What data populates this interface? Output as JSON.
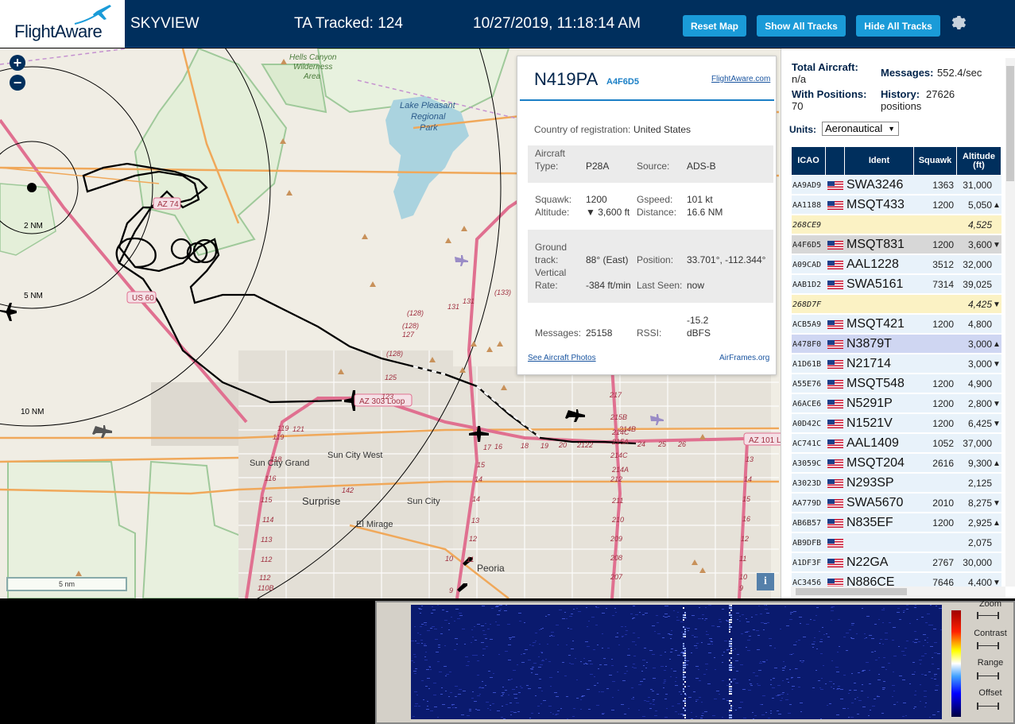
{
  "header": {
    "logo_text": "FlightAware",
    "title": "SKYVIEW",
    "tracked": "TA Tracked: 124",
    "datetime": "10/27/2019, 11:18:14 AM",
    "reset_map": "Reset Map",
    "show_all": "Show All Tracks",
    "hide_all": "Hide All Tracks"
  },
  "map": {
    "zoom_in": "+",
    "zoom_out": "−",
    "range_rings": [
      "2 NM",
      "5 NM",
      "10 NM"
    ],
    "scale": "5 nm",
    "info": "i",
    "place_labels": [
      "Hells Canyon Wilderness Area",
      "Lake Pleasant Regional Park",
      "Sun City Grand",
      "Sun City West",
      "Surprise",
      "Sun City",
      "El Mirage",
      "Peoria"
    ],
    "road_shields": [
      "AZ 74",
      "US 60",
      "AZ 303 Loop",
      "AZ 101 Lo"
    ],
    "road_numbers": [
      "131",
      "(128)",
      "127",
      "(133)",
      "(128)",
      "125",
      "123",
      "121",
      "119",
      "118",
      "117",
      "116",
      "115",
      "114",
      "113",
      "112",
      "110B",
      "142",
      "18",
      "17",
      "16",
      "15",
      "14",
      "13",
      "12",
      "11",
      "10",
      "9",
      "217",
      "215B",
      "214C",
      "214B",
      "215A",
      "214C",
      "212",
      "214A",
      "211",
      "210",
      "209",
      "208",
      "207",
      "24",
      "25",
      "26",
      "22",
      "21",
      "20",
      "19",
      "13",
      "12",
      "11",
      "10",
      "9",
      "14",
      "15",
      "16"
    ]
  },
  "popup": {
    "registration": "N419PA",
    "hex": "A4F6D5",
    "fa_link": "FlightAware.com",
    "country_label": "Country of registration:",
    "country": "United States",
    "aircraft_type_label": "Aircraft Type:",
    "aircraft_type_label_1": "Aircraft",
    "aircraft_type_label_2": "Type:",
    "aircraft_type": "P28A",
    "source_label": "Source:",
    "source": "ADS-B",
    "squawk_label": "Squawk:",
    "squawk": "1200",
    "gspeed_label": "Gspeed:",
    "gspeed": "101 kt",
    "altitude_label": "Altitude:",
    "altitude": "▼ 3,600 ft",
    "distance_label": "Distance:",
    "distance": "16.6 NM",
    "ground_track_label_1": "Ground",
    "ground_track_label_2": "track:",
    "ground_track": "88° (East)",
    "position_label": "Position:",
    "position": "33.701°, -112.344°",
    "vrate_label_1": "Vertical",
    "vrate_label_2": "Rate:",
    "vrate": "-384 ft/min",
    "last_seen_label": "Last Seen:",
    "last_seen": "now",
    "messages_label": "Messages:",
    "messages": "25158",
    "rssi_label": "RSSI:",
    "rssi_1": "-15.2",
    "rssi_2": "dBFS",
    "photos_link": "See Aircraft Photos",
    "airframes_link": "AirFrames.org"
  },
  "sidebar": {
    "total_label": "Total Aircraft:",
    "total": "n/a",
    "messages_label": "Messages:",
    "messages": "552.4/sec",
    "with_pos_label": "With Positions:",
    "with_pos": "70",
    "history_label": "History:",
    "history_1": "27626",
    "history_2": "positions",
    "units_label": "Units:",
    "units": "Aeronautical",
    "columns": [
      "ICAO",
      "",
      "Ident",
      "Squawk",
      "Altitude (ft)"
    ],
    "col_alt_1": "Altitude",
    "col_alt_2": "(ft)",
    "rows": [
      {
        "icao": "AA9AD9",
        "flag": true,
        "ident": "SWA3246",
        "squawk": "1363",
        "alt": "31,000",
        "trend": "",
        "bg": "#e8f2fa"
      },
      {
        "icao": "AA1188",
        "flag": true,
        "ident": "MSQT433",
        "squawk": "1200",
        "alt": "5,050",
        "trend": "▲",
        "bg": "#e8f2fa"
      },
      {
        "icao": "268CE9",
        "flag": false,
        "ident": "",
        "squawk": "",
        "alt": "4,525",
        "trend": "",
        "bg": "#fbf2c4",
        "italic": true
      },
      {
        "icao": "A4F6D5",
        "flag": true,
        "ident": "MSQT831",
        "squawk": "1200",
        "alt": "3,600",
        "trend": "▼",
        "bg": "#d7d7d7"
      },
      {
        "icao": "A09CAD",
        "flag": true,
        "ident": "AAL1228",
        "squawk": "3512",
        "alt": "32,000",
        "trend": "",
        "bg": "#e8f2fa"
      },
      {
        "icao": "AAB1D2",
        "flag": true,
        "ident": "SWA5161",
        "squawk": "7314",
        "alt": "39,025",
        "trend": "",
        "bg": "#e8f2fa"
      },
      {
        "icao": "268D7F",
        "flag": false,
        "ident": "",
        "squawk": "",
        "alt": "4,425",
        "trend": "▼",
        "bg": "#fbf2c4",
        "italic": true
      },
      {
        "icao": "ACB5A9",
        "flag": true,
        "ident": "MSQT421",
        "squawk": "1200",
        "alt": "4,800",
        "trend": "",
        "bg": "#e8f2fa"
      },
      {
        "icao": "A478F0",
        "flag": true,
        "ident": "N3879T",
        "squawk": "",
        "alt": "3,000",
        "trend": "▲",
        "bg": "#cfd6f2"
      },
      {
        "icao": "A1D61B",
        "flag": true,
        "ident": "N21714",
        "squawk": "",
        "alt": "3,000",
        "trend": "▼",
        "bg": "#e8f2fa"
      },
      {
        "icao": "A55E76",
        "flag": true,
        "ident": "MSQT548",
        "squawk": "1200",
        "alt": "4,900",
        "trend": "",
        "bg": "#e8f2fa"
      },
      {
        "icao": "A6ACE6",
        "flag": true,
        "ident": "N5291P",
        "squawk": "1200",
        "alt": "2,800",
        "trend": "▼",
        "bg": "#e8f2fa"
      },
      {
        "icao": "A0D42C",
        "flag": true,
        "ident": "N1521V",
        "squawk": "1200",
        "alt": "6,425",
        "trend": "▼",
        "bg": "#e8f2fa"
      },
      {
        "icao": "AC741C",
        "flag": true,
        "ident": "AAL1409",
        "squawk": "1052",
        "alt": "37,000",
        "trend": "",
        "bg": "#e8f2fa"
      },
      {
        "icao": "A3059C",
        "flag": true,
        "ident": "MSQT204",
        "squawk": "2616",
        "alt": "9,300",
        "trend": "▲",
        "bg": "#e8f2fa"
      },
      {
        "icao": "A3023D",
        "flag": true,
        "ident": "N293SP",
        "squawk": "",
        "alt": "2,125",
        "trend": "",
        "bg": "#e8f2fa"
      },
      {
        "icao": "AA779D",
        "flag": true,
        "ident": "SWA5670",
        "squawk": "2010",
        "alt": "8,275",
        "trend": "▼",
        "bg": "#e8f2fa"
      },
      {
        "icao": "AB6B57",
        "flag": true,
        "ident": "N835EF",
        "squawk": "1200",
        "alt": "2,925",
        "trend": "▲",
        "bg": "#e8f2fa"
      },
      {
        "icao": "AB9DFB",
        "flag": true,
        "ident": "",
        "squawk": "",
        "alt": "2,075",
        "trend": "",
        "bg": "#e8f2fa"
      },
      {
        "icao": "A1DF3F",
        "flag": true,
        "ident": "N22GA",
        "squawk": "2767",
        "alt": "30,000",
        "trend": "",
        "bg": "#e8f2fa"
      },
      {
        "icao": "AC3456",
        "flag": true,
        "ident": "N886CE",
        "squawk": "7646",
        "alt": "4,400",
        "trend": "▼",
        "bg": "#e8f2fa"
      }
    ]
  },
  "waterfall": {
    "controls": [
      "Zoom",
      "Contrast",
      "Range",
      "Offset"
    ]
  },
  "colors": {
    "header_bg": "#002f5d",
    "button_bg": "#1a9bd8",
    "table_head": "#002f5d"
  }
}
